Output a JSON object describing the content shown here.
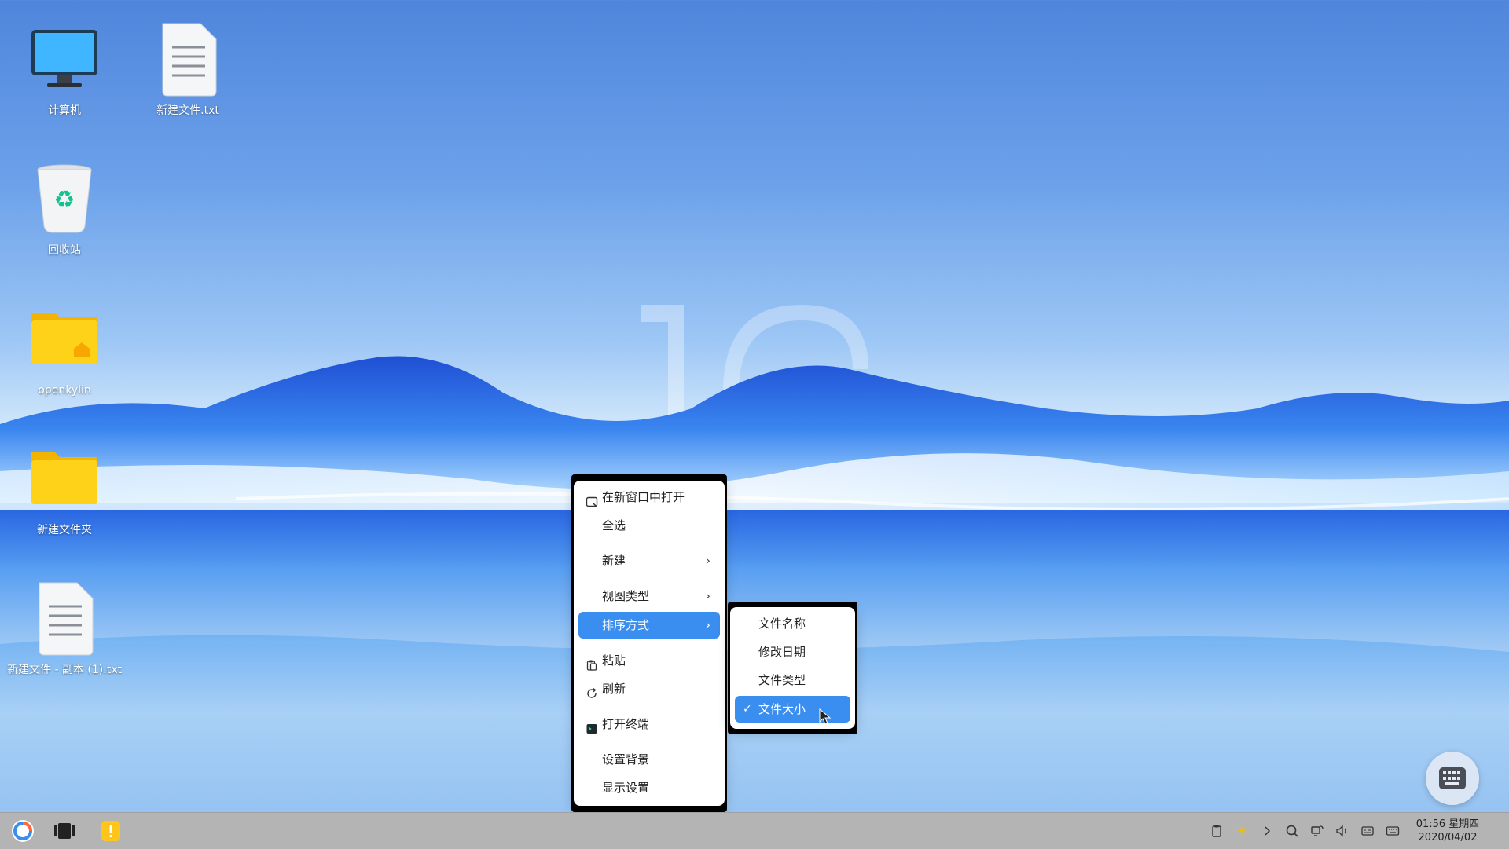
{
  "desktop": {
    "icons": [
      {
        "label": "计算机",
        "icon": "computer-icon"
      },
      {
        "label": "新建文件.txt",
        "icon": "text-file-icon"
      },
      {
        "label": "回收站",
        "icon": "trash-icon"
      },
      {
        "label": "openkylin",
        "icon": "home-folder-icon"
      },
      {
        "label": "新建文件夹",
        "icon": "folder-icon"
      },
      {
        "label": "新建文件 - 副本 (1).txt",
        "icon": "text-file-icon"
      }
    ]
  },
  "context_menu": {
    "items": [
      {
        "label": "在新窗口中打开",
        "icon": "open-window-icon"
      },
      {
        "label": "全选"
      },
      {
        "label": "新建",
        "submenu": true
      },
      {
        "label": "视图类型",
        "submenu": true
      },
      {
        "label": "排序方式",
        "submenu": true,
        "active": true
      },
      {
        "label": "粘贴",
        "icon": "paste-icon"
      },
      {
        "label": "刷新",
        "icon": "refresh-icon"
      },
      {
        "label": "打开终端",
        "icon": "terminal-icon"
      },
      {
        "label": "设置背景"
      },
      {
        "label": "显示设置"
      }
    ],
    "arrow_glyph": "›"
  },
  "sort_submenu": {
    "items": [
      {
        "label": "文件名称"
      },
      {
        "label": "修改日期"
      },
      {
        "label": "文件类型"
      },
      {
        "label": "文件大小",
        "checked": true,
        "active": true
      }
    ],
    "check_glyph": "✓"
  },
  "taskbar": {
    "time": "01:56 星期四",
    "date": "2020/04/02",
    "tray_icons": [
      "clipboard-icon",
      "brightness-icon",
      "chevron-right-icon",
      "search-icon",
      "network-icon",
      "volume-icon",
      "input-method-icon",
      "keyboard-icon"
    ]
  },
  "colors": {
    "accent": "#3a8ef0",
    "taskbar": "#b4b4b4",
    "folder": "#f9c800"
  }
}
